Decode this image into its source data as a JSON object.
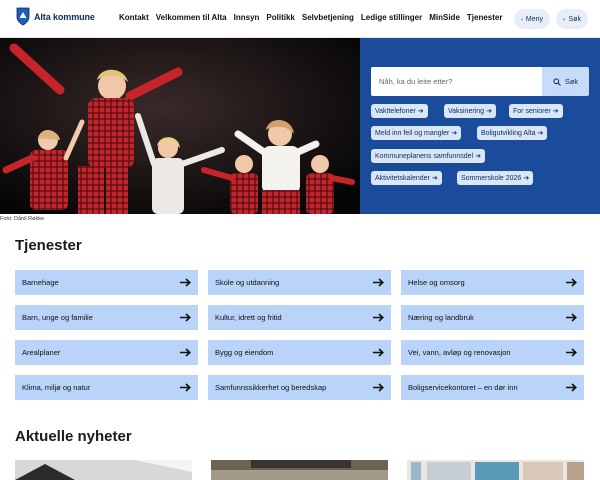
{
  "header": {
    "logo_text": "Alta kommune",
    "nav": [
      "Kontakt",
      "Velkommen til Alta",
      "Innsyn",
      "Politikk",
      "Selvbetjening",
      "Ledige stillinger",
      "MinSide",
      "Tjenester"
    ],
    "menu_label": "Meny",
    "search_label": "Søk"
  },
  "hero": {
    "photo_caption": "Foto: Dånil Røkke",
    "search_placeholder": "Nåh, ka du leite etter?",
    "search_button": "Søk",
    "quick_links": [
      "Vakttelefoner",
      "Vaksinering",
      "For seniorer",
      "Meld inn feil og mangler",
      "Boligutvikling Alta",
      "Kommuneplanens samfunnsdel",
      "Aktivitetskalender",
      "Sommerskole 2026"
    ]
  },
  "services": {
    "title": "Tjenester",
    "items": [
      "Barnehage",
      "Skole og utdanning",
      "Helse og omsorg",
      "Barn, unge og familie",
      "Kultur, idrett og fritid",
      "Næring og landbruk",
      "Arealplaner",
      "Bygg og eiendom",
      "Vei, vann, avløp og renovasjon",
      "Klima, miljø og natur",
      "Samfunnssikkerhet og beredskap",
      "Boligservicekontoret – en dør inn"
    ]
  },
  "news": {
    "title": "Aktuelle nyheter"
  },
  "colors": {
    "brand_dark": "#1b4b9b",
    "card_bg": "#b9d4f8",
    "chip_bg": "#d9e6f7"
  }
}
